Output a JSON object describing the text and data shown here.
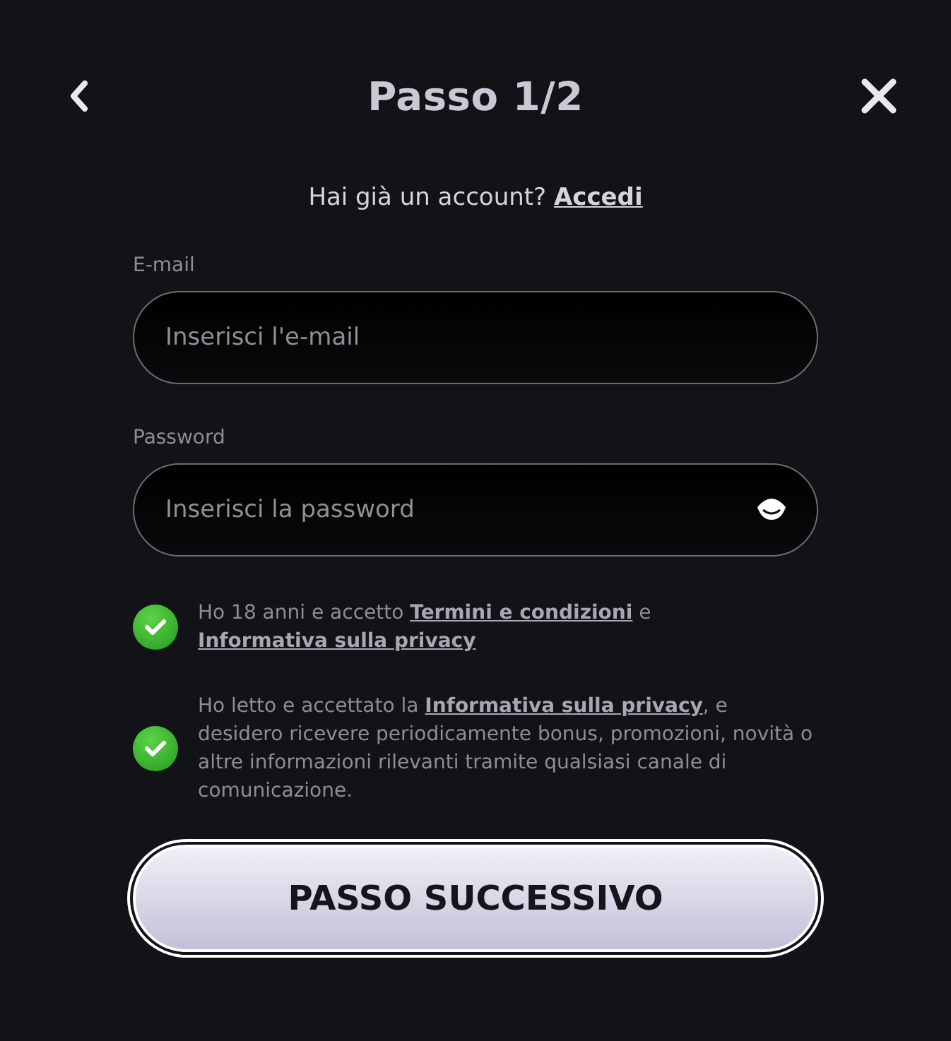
{
  "header": {
    "title": "Passo 1/2"
  },
  "login_prompt": {
    "text": "Hai già un account?",
    "link": "Accedi"
  },
  "fields": [
    {
      "kind": "email",
      "label": "E-mail",
      "placeholder": "Inserisci l'e-mail"
    },
    {
      "kind": "password",
      "label": "Password",
      "placeholder": "Inserisci la password"
    }
  ],
  "consents": [
    {
      "checked": true,
      "segments": [
        {
          "kind": "text",
          "text": "Ho 18 anni e accetto "
        },
        {
          "kind": "link",
          "text": "Termini e condizioni"
        },
        {
          "kind": "text",
          "text": " e "
        },
        {
          "kind": "link",
          "text": "Informativa sulla privacy"
        }
      ]
    },
    {
      "checked": true,
      "segments": [
        {
          "kind": "text",
          "text": "Ho letto e accettato la "
        },
        {
          "kind": "link",
          "text": "Informativa sulla privacy"
        },
        {
          "kind": "text",
          "text": ", e desidero ricevere periodicamente bonus, promozioni, novità o altre informazioni rilevanti tramite qualsiasi canale di comunicazione."
        }
      ]
    }
  ],
  "submit_button": "PASSO SUCCESSIVO"
}
